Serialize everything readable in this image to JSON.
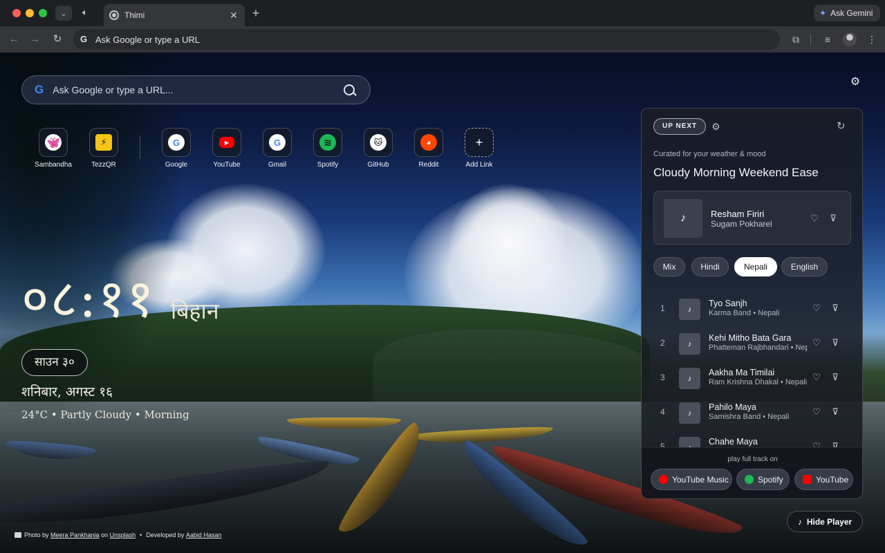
{
  "browser": {
    "tab_title": "Thimi",
    "omnibox_text": "Ask Google or type a URL",
    "gemini_label": "Ask Gemini"
  },
  "search": {
    "placeholder": "Ask Google or type a URL..."
  },
  "shortcuts": [
    {
      "label": "Sambandha",
      "icon": "butterfly-icon"
    },
    {
      "label": "TezzQR",
      "icon": "lightning-icon"
    },
    {
      "label": "Google",
      "icon": "google-icon"
    },
    {
      "label": "YouTube",
      "icon": "youtube-icon"
    },
    {
      "label": "Gmail",
      "icon": "google-icon"
    },
    {
      "label": "Spotify",
      "icon": "spotify-icon"
    },
    {
      "label": "GitHub",
      "icon": "github-icon"
    },
    {
      "label": "Reddit",
      "icon": "reddit-icon"
    },
    {
      "label": "Add Link",
      "icon": "plus-icon"
    }
  ],
  "clock": {
    "time": "०८:११",
    "period": "बिहान",
    "bs_date": "साउन ३०",
    "date_line": "शनिबार, अगस्ट १६",
    "weather_line": "24°C • Partly Cloudy • Morning"
  },
  "player": {
    "badge": "UP NEXT",
    "curated_caption": "Curated for your weather & mood",
    "mood_title": "Cloudy Morning Weekend Ease",
    "now_playing": {
      "title": "Resham Firiri",
      "artist": "Sugam Pokharel"
    },
    "filters": [
      {
        "label": "Mix",
        "active": false
      },
      {
        "label": "Hindi",
        "active": false
      },
      {
        "label": "Nepali",
        "active": true
      },
      {
        "label": "English",
        "active": false
      }
    ],
    "tracks": [
      {
        "num": "1",
        "title": "Tyo Sanjh",
        "meta": "Karma Band • Nepali"
      },
      {
        "num": "2",
        "title": "Kehi Mitho Bata Gara",
        "meta": "Phatteman Rajbhandari • Nepali"
      },
      {
        "num": "3",
        "title": "Aakha Ma Timilai",
        "meta": "Ram Krishna Dhakal • Nepali"
      },
      {
        "num": "4",
        "title": "Pahilo Maya",
        "meta": "Samishra Band • Nepali"
      },
      {
        "num": "5",
        "title": "Chahe Maya",
        "meta": ""
      }
    ],
    "footer_caption": "play full track on",
    "services": [
      {
        "label": "YouTube Music",
        "color": "#ff0000"
      },
      {
        "label": "Spotify",
        "color": "#1db954"
      },
      {
        "label": "YouTube",
        "color": "#ff0000"
      }
    ],
    "hide_label": "Hide Player"
  },
  "credits": {
    "photo_prefix": "Photo by",
    "photographer": "Meera Pankhania",
    "on": "on",
    "source": "Unsplash",
    "dev_prefix": "Developed by",
    "developer": "Aabid Hasan"
  }
}
